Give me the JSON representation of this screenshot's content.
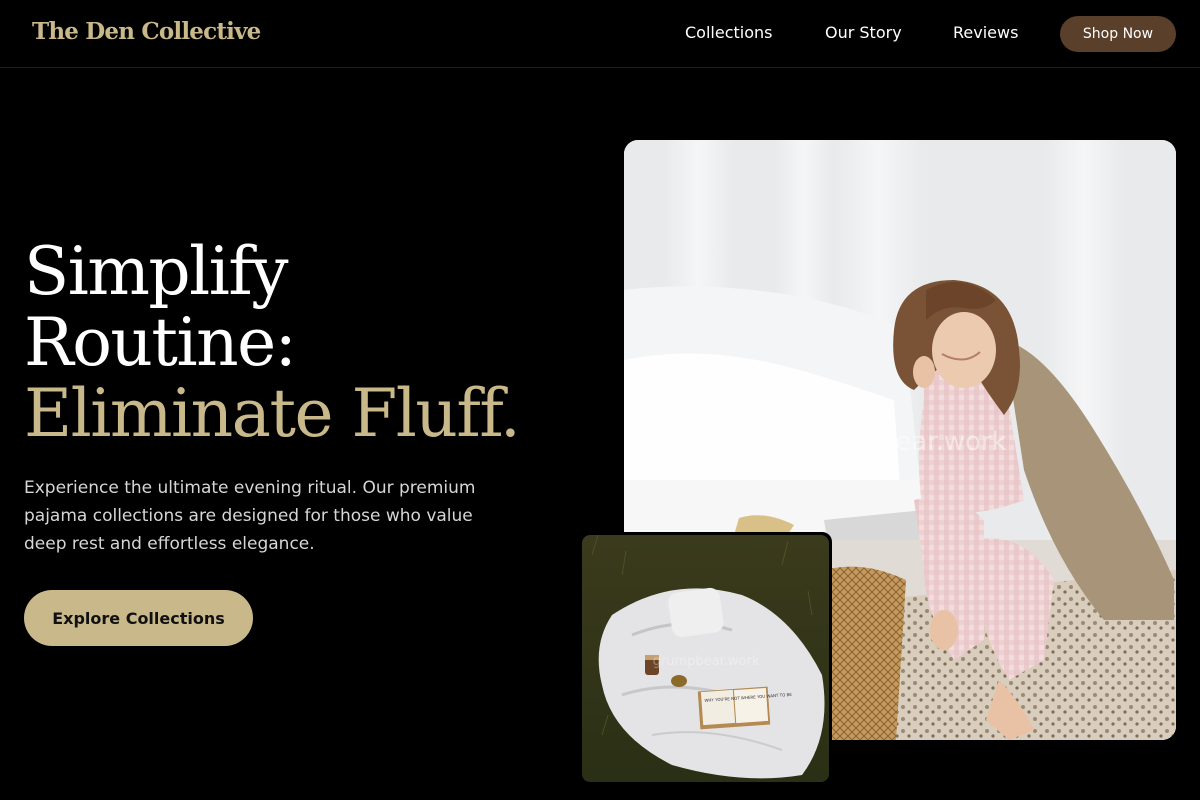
{
  "brand": {
    "name": "The Den Collective",
    "accent_color": "#c8b88a",
    "button_brown": "#5a3f2a"
  },
  "nav": {
    "links": [
      {
        "label": "Collections"
      },
      {
        "label": "Our Story"
      },
      {
        "label": "Reviews"
      }
    ],
    "cta_label": "Shop Now"
  },
  "hero": {
    "title_lines": [
      "Simplify",
      "Routine:",
      "Eliminate Fluff."
    ],
    "description": "Experience the ultimate evening ritual. Our premium pajama collections are designed for those who value deep rest and effortless elegance.",
    "cta_label": "Explore Collections"
  },
  "images": {
    "main_watermark": "grumpbear.work",
    "inset_watermark": "grumpbear.work",
    "book_cover_text": "WHY YOU'RE NOT WHERE YOU WANT TO BE"
  }
}
